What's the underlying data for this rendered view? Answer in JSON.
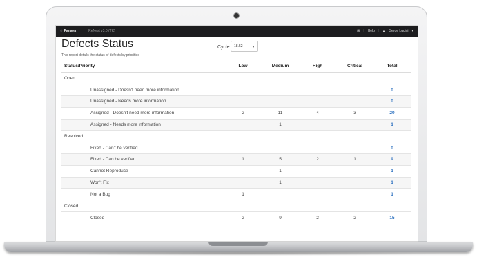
{
  "topbar": {
    "brand": "Panaya",
    "project": "ReNext v3.0 (TK)",
    "help": "Help",
    "user": "Serge Lucini"
  },
  "report": {
    "title": "Defects Status",
    "description": "This report details the status of defects by priorities",
    "cycle_label": "Cycle:",
    "cycle_value": "18.52"
  },
  "table": {
    "headers": [
      "Status/Priority",
      "Low",
      "Medium",
      "High",
      "Critical",
      "Total"
    ],
    "rows": [
      {
        "kind": "group",
        "label": "Open"
      },
      {
        "kind": "row",
        "label": "Unassigned - Doesn't need more information",
        "low": "",
        "medium": "",
        "high": "",
        "critical": "",
        "total": "0"
      },
      {
        "kind": "row",
        "label": "Unassigned - Needs more information",
        "low": "",
        "medium": "",
        "high": "",
        "critical": "",
        "total": "0"
      },
      {
        "kind": "row",
        "label": "Assigned - Doesn't need more information",
        "low": "2",
        "medium": "11",
        "high": "4",
        "critical": "3",
        "total": "20"
      },
      {
        "kind": "row",
        "label": "Assigned - Needs more information",
        "low": "",
        "medium": "1",
        "high": "",
        "critical": "",
        "total": "1"
      },
      {
        "kind": "group",
        "label": "Resolved"
      },
      {
        "kind": "row",
        "label": "Fixed - Can't be verified",
        "low": "",
        "medium": "",
        "high": "",
        "critical": "",
        "total": "0"
      },
      {
        "kind": "row",
        "label": "Fixed - Can be verified",
        "low": "1",
        "medium": "5",
        "high": "2",
        "critical": "1",
        "total": "9"
      },
      {
        "kind": "row",
        "label": "Cannot Reproduce",
        "low": "",
        "medium": "1",
        "high": "",
        "critical": "",
        "total": "1"
      },
      {
        "kind": "row",
        "label": "Won't Fix",
        "low": "",
        "medium": "1",
        "high": "",
        "critical": "",
        "total": "1"
      },
      {
        "kind": "row",
        "label": "Not a Bug",
        "low": "1",
        "medium": "",
        "high": "",
        "critical": "",
        "total": "1"
      },
      {
        "kind": "group",
        "label": "Closed"
      },
      {
        "kind": "row",
        "label": "Closed",
        "low": "2",
        "medium": "9",
        "high": "2",
        "critical": "2",
        "total": "15"
      }
    ]
  },
  "colors": {
    "topbar_bg": "#1d1d1f",
    "total_link": "#2a6fbf",
    "stripe": "#f6f6f6"
  },
  "icons": {
    "brand": "panaya-logo-icon",
    "grid": "grid-icon",
    "user": "user-icon",
    "caret": "caret-down-icon"
  }
}
